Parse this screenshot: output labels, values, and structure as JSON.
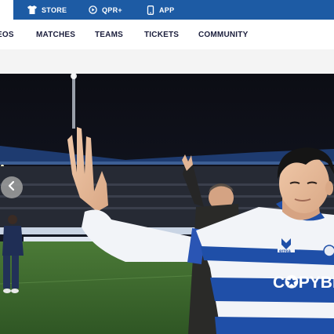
{
  "utility_nav": {
    "store": {
      "label": "STORE",
      "icon": "shirt-icon"
    },
    "qpr_plus": {
      "label": "QPR+",
      "icon": "play-circle-icon"
    },
    "app": {
      "label": "APP",
      "icon": "phone-icon"
    }
  },
  "main_nav": {
    "items": [
      "EOS",
      "MATCHES",
      "TEAMS",
      "TICKETS",
      "COMMUNITY"
    ]
  },
  "hero": {
    "sponsor_text": "C✪PYBE",
    "kit_brand": "errea"
  },
  "carousel": {
    "prev_icon": "chevron-left-icon"
  },
  "colors": {
    "brand_blue": "#1d5ba4",
    "nav_text": "#1b1e3c",
    "kit_blue": "#1f4fa8"
  }
}
